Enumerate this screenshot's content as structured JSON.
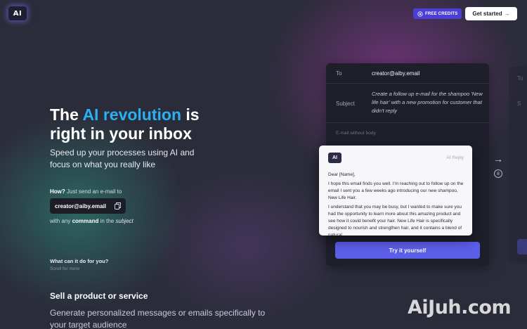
{
  "colors": {
    "accent_blue": "#2bb0f2",
    "button_purple": "#5b5ee8",
    "credits_badge": "#4b3fd6",
    "background": "#2b2c3a"
  },
  "header": {
    "logo_text": "AI",
    "credits_icon": "coin-icon",
    "credits_label": "FREE CREDITS",
    "get_started_label": "Get started",
    "get_started_arrow": "→"
  },
  "hero": {
    "title_part1": "The ",
    "title_accent": "AI revolution",
    "title_part2": " is",
    "title_line2": "right in your inbox",
    "subtitle": "Speed up your processes using AI and focus on what you really like",
    "how_label": "How?",
    "how_text": " Just send an e-mail to",
    "email": "creator@aiby.email",
    "copy_icon": "copy-icon",
    "with_any": "with any ",
    "command": "command",
    "in_the": " in the ",
    "subject_word": "subject",
    "what_can": "What can it do for you?",
    "scroll_more": "Scroll for more"
  },
  "feature": {
    "title": "Sell a product or service",
    "description": "Generate personalized messages or emails specifically to your target audience"
  },
  "email_card": {
    "to_label": "To",
    "to_value": "creator@aiby.email",
    "subject_label": "Subject",
    "subject_value": "Create a follow up e-mail for the shampoo 'New life hair' with a new promotion for customer that didn't reply",
    "no_body": "E-mail without body",
    "try_button": "Try it yourself"
  },
  "reply_card": {
    "logo_text": "AI",
    "tag": "AI Reply",
    "greeting": "Dear [Name],",
    "para1": "I hope this email finds you well. I'm reaching out to follow up on the email I sent you a few weeks ago introducing our new shampoo, New Life Hair.",
    "para2": "I understand that you may be busy, but I wanted to make sure you had the opportunity to learn more about this amazing product and see how it could benefit your hair. New Life Hair is specifically designed to nourish and strengthen hair, and it contains a blend of natural"
  },
  "stepper": {
    "arrow": "→",
    "step": "8"
  },
  "ghost_card": {
    "to_label": "To",
    "subject_label": "S"
  },
  "watermark": "AiJuh.com"
}
